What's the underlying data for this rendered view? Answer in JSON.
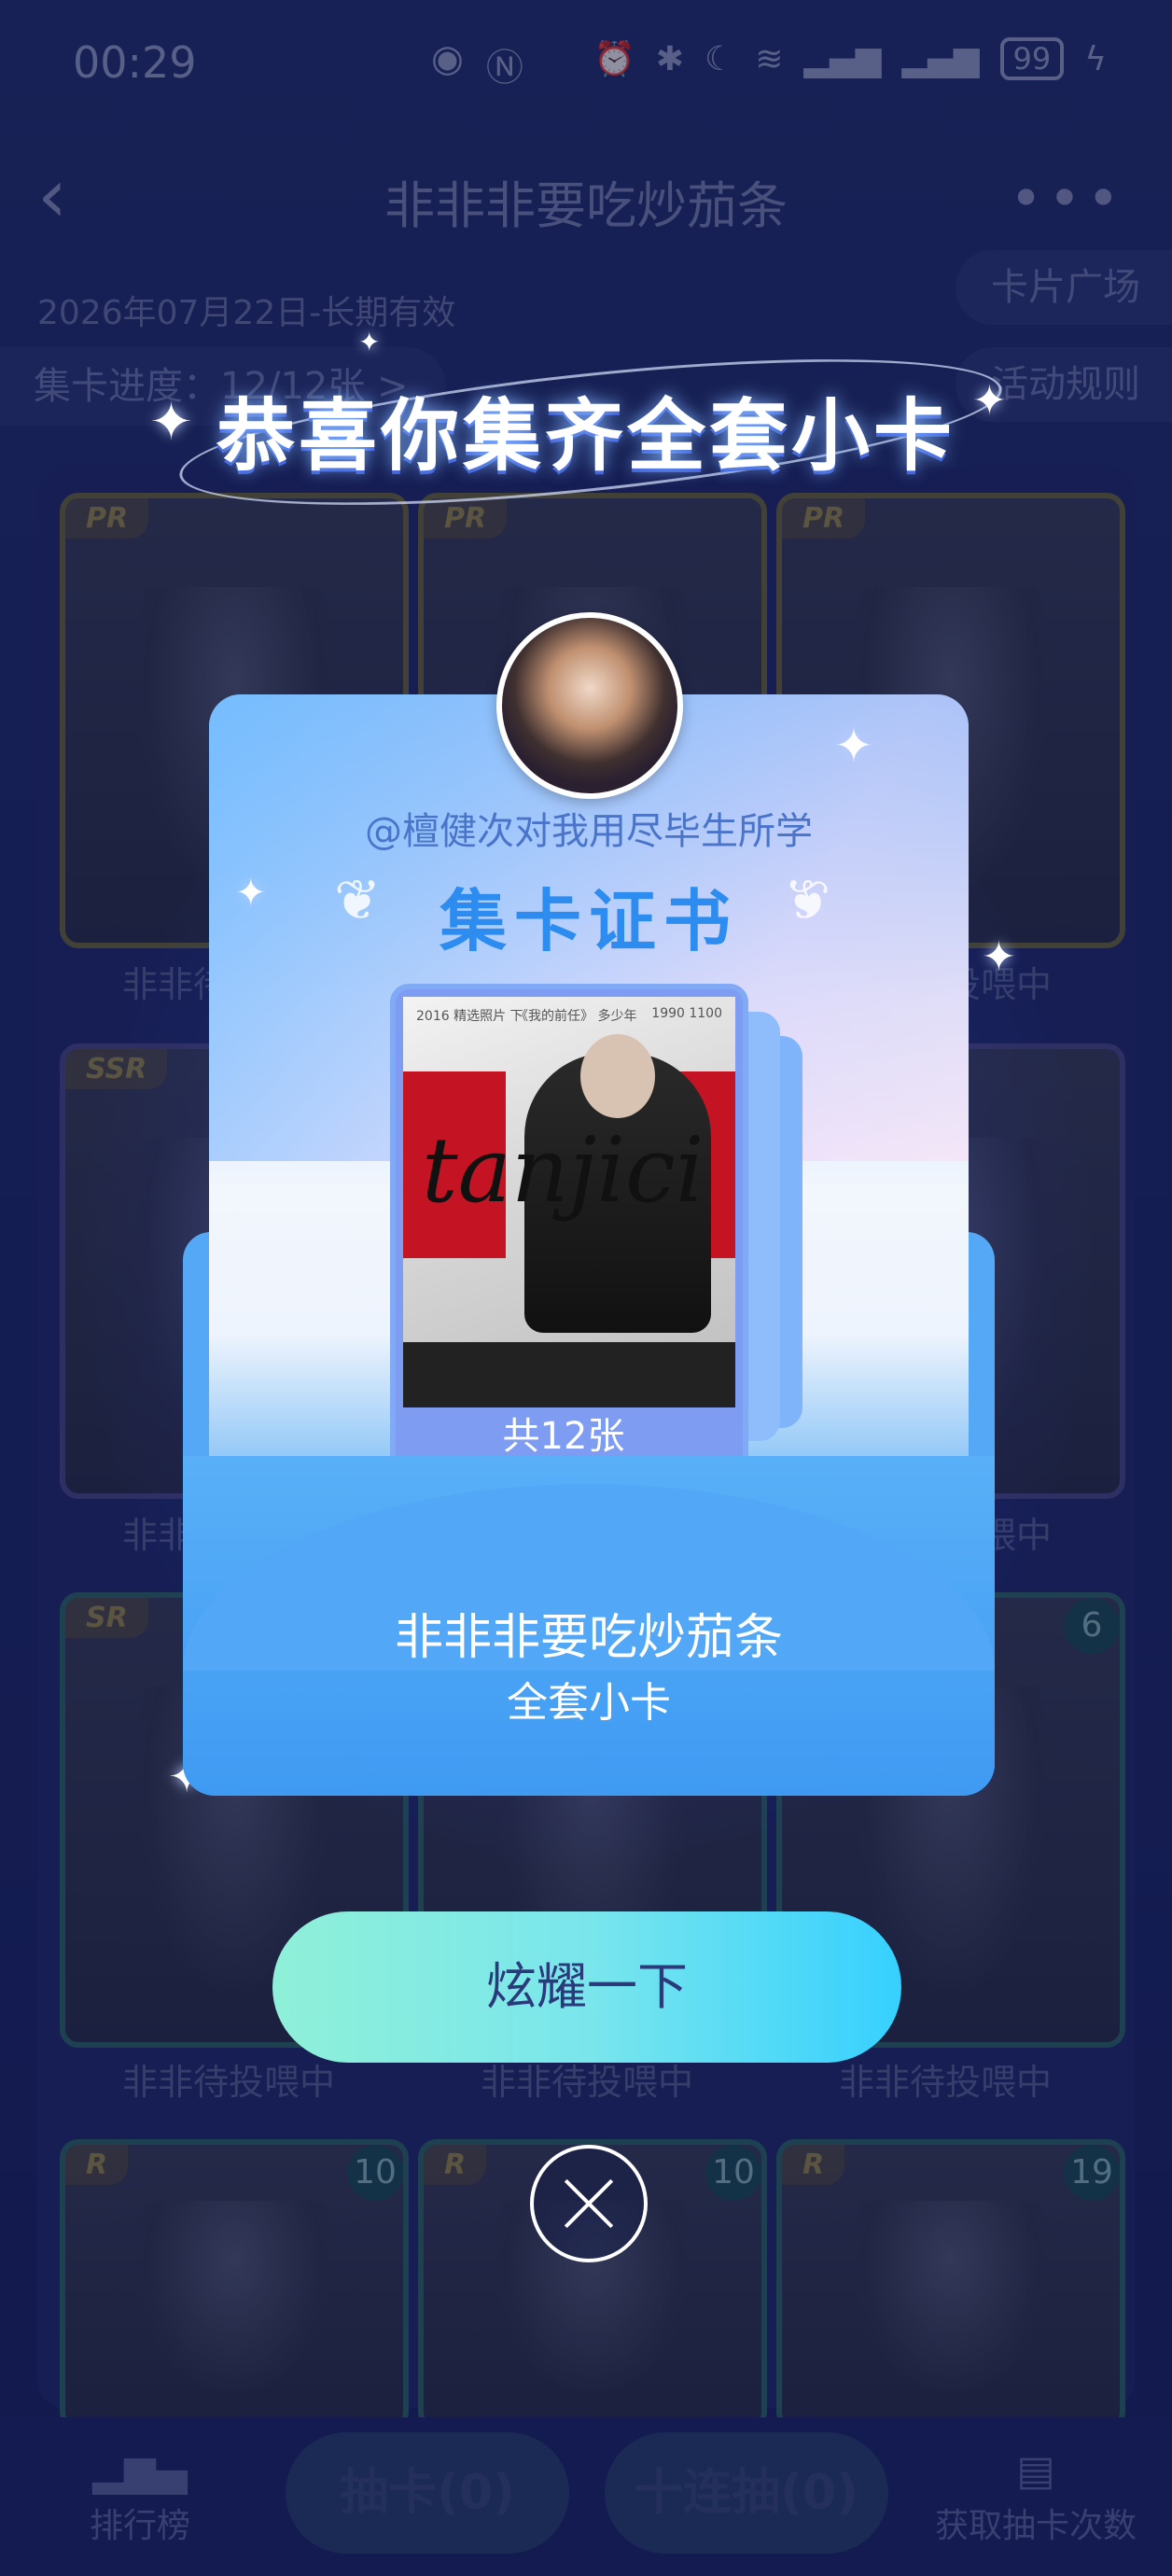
{
  "status_bar": {
    "time": "00:29",
    "battery": "99",
    "icons": [
      "eye-icon",
      "nfc-icon",
      "alarm-icon",
      "bluetooth-icon",
      "moon-icon",
      "wifi-icon",
      "signal-icon",
      "signal-icon",
      "charging-icon"
    ]
  },
  "header": {
    "title": "非非非要吃炒茄条",
    "valid": "2026年07月22日-长期有效",
    "progress": "集卡进度：12/12张 >",
    "card_square": "卡片广场",
    "rules": "活动规则"
  },
  "grid": {
    "rows": [
      [
        {
          "rarity": "PR",
          "count": "",
          "caption": "非非待投喂中"
        },
        {
          "rarity": "PR",
          "count": "",
          "caption": ""
        },
        {
          "rarity": "PR",
          "count": "",
          "caption": "非非待投喂中"
        }
      ],
      [
        {
          "rarity": "SSR",
          "count": "",
          "caption": "非非待投喂中"
        },
        {
          "rarity": "",
          "count": "",
          "caption": ""
        },
        {
          "rarity": "",
          "count": "",
          "caption": "非非待投喂中"
        }
      ],
      [
        {
          "rarity": "SR",
          "count": "",
          "caption": "非非待投喂中"
        },
        {
          "rarity": "",
          "count": "",
          "caption": "非非待投喂中"
        },
        {
          "rarity": "",
          "count": "6",
          "caption": "非非待投喂中"
        }
      ],
      [
        {
          "rarity": "R",
          "count": "10",
          "caption": ""
        },
        {
          "rarity": "R",
          "count": "10",
          "caption": ""
        },
        {
          "rarity": "R",
          "count": "19",
          "caption": ""
        }
      ]
    ]
  },
  "bottom_bar": {
    "ranking": "排行榜",
    "draw": "抽卡(0)",
    "draw_ten": "十连抽(0)",
    "get_draws": "获取抽卡次数"
  },
  "modal": {
    "congrats": "恭喜你集齐全套小卡",
    "username": "@檀健次对我用尽毕生所学",
    "certificate_title": "集卡证书",
    "card_count": "共12张",
    "set_name": "非非非要吃炒茄条",
    "set_subtitle": "全套小卡",
    "show_off_button": "炫耀一下",
    "card_art": {
      "script_text": "tanjici",
      "top_left": "2016 精选照片 下",
      "top_middle": "《我的前任》 多少年",
      "top_right": "1990 1100"
    }
  },
  "colors": {
    "accent": "#2d8cf0",
    "button_gradient_start": "#8ff0d8",
    "button_gradient_end": "#36d0ff",
    "background": "#1b2666"
  }
}
